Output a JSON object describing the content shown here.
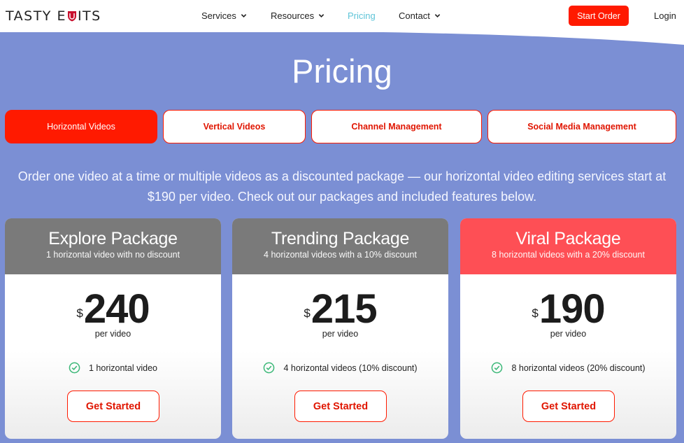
{
  "brand": {
    "logo_text": "TASTY EDITS",
    "logo_left": "TASTY E",
    "logo_right": "ITS"
  },
  "nav": {
    "items": [
      {
        "label": "Services",
        "has_dropdown": true
      },
      {
        "label": "Resources",
        "has_dropdown": true
      },
      {
        "label": "Pricing",
        "has_dropdown": false,
        "active": true
      },
      {
        "label": "Contact",
        "has_dropdown": true
      }
    ],
    "cta_label": "Start Order",
    "login_label": "Login"
  },
  "page": {
    "title": "Pricing"
  },
  "tabs": [
    {
      "label": "Horizontal Videos",
      "active": true
    },
    {
      "label": "Vertical Videos",
      "active": false
    },
    {
      "label": "Channel Management",
      "active": false
    },
    {
      "label": "Social Media Management",
      "active": false
    }
  ],
  "intro": "Order one video at a time or multiple videos as a discounted package — our horizontal video editing services start at $190 per video. Check out our packages and included features below.",
  "packages": [
    {
      "title": "Explore Package",
      "subtitle": "1 horizontal video with no discount",
      "currency": "$",
      "price": "240",
      "per": "per video",
      "feature": "1 horizontal video",
      "button": "Get Started"
    },
    {
      "title": "Trending Package",
      "subtitle": "4 horizontal videos with a 10% discount",
      "currency": "$",
      "price": "215",
      "per": "per video",
      "feature": "4 horizontal videos (10% discount)",
      "button": "Get Started"
    },
    {
      "title": "Viral Package",
      "subtitle": "8 horizontal videos with a 20% discount",
      "currency": "$",
      "price": "190",
      "per": "per video",
      "feature": "8 horizontal videos (20% discount)",
      "button": "Get Started"
    }
  ],
  "colors": {
    "accent": "#ff1a00",
    "hero": "#7b8fd4",
    "card_head": "#7a7a7a",
    "card_head_featured": "#fe4f55",
    "nav_active": "#5ec4d8",
    "check": "#3cb878"
  },
  "icons": {
    "nav_dropdown": "chevron-down-icon",
    "feature": "check-circle-icon",
    "logo_mark": "shield-icon"
  }
}
